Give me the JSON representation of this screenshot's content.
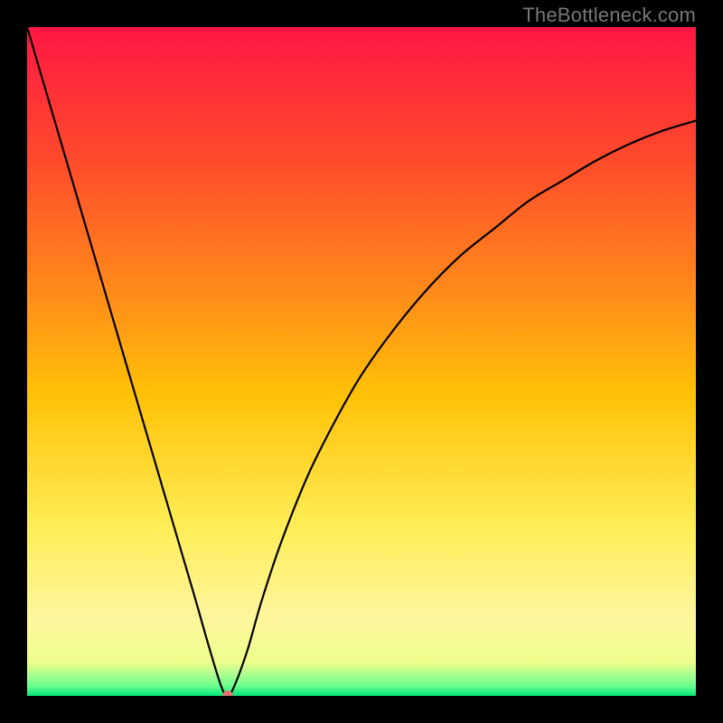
{
  "watermark": "TheBottleneck.com",
  "chart_data": {
    "type": "line",
    "title": "",
    "xlabel": "",
    "ylabel": "",
    "xlim": [
      0,
      100
    ],
    "ylim": [
      0,
      100
    ],
    "grid": false,
    "legend": false,
    "background_gradient": {
      "stops": [
        {
          "pos": 0.0,
          "color": "#ff1744"
        },
        {
          "pos": 0.2,
          "color": "#ff4b2b"
        },
        {
          "pos": 0.4,
          "color": "#ff8c1a"
        },
        {
          "pos": 0.55,
          "color": "#ffc107"
        },
        {
          "pos": 0.75,
          "color": "#ffee58"
        },
        {
          "pos": 0.88,
          "color": "#fff59d"
        },
        {
          "pos": 0.95,
          "color": "#eeff8d"
        },
        {
          "pos": 0.985,
          "color": "#6bff90"
        },
        {
          "pos": 1.0,
          "color": "#00e676"
        }
      ]
    },
    "series": [
      {
        "name": "bottleneck-curve",
        "x": [
          0,
          5,
          10,
          15,
          20,
          25,
          27,
          29,
          30,
          31,
          33,
          35,
          38,
          42,
          46,
          50,
          55,
          60,
          65,
          70,
          75,
          80,
          85,
          90,
          95,
          100
        ],
        "y": [
          100,
          83,
          66,
          49,
          32,
          15,
          8,
          1.5,
          0,
          1.5,
          7,
          14,
          23,
          33,
          41,
          48,
          55,
          61,
          66,
          70,
          74,
          77,
          80,
          82.5,
          84.5,
          86
        ]
      }
    ],
    "marker": {
      "x": 30,
      "y": 0,
      "color": "#e57373",
      "radius": 6
    }
  }
}
